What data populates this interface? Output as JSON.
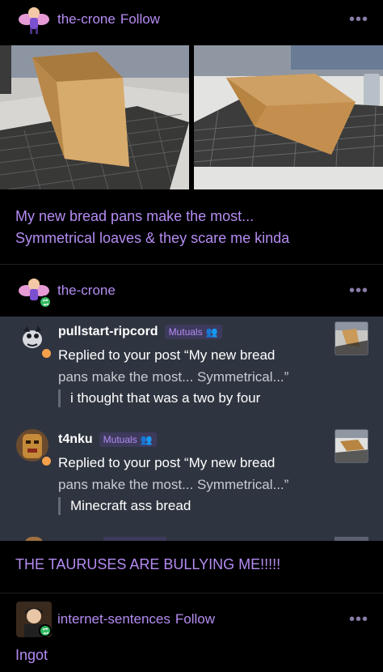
{
  "post1": {
    "blog": "the-crone",
    "follow": "Follow",
    "more": "•••",
    "text_line1": "My new bread pans make the most...",
    "text_line2": "Symmetrical loaves & they scare me kinda"
  },
  "reblog": {
    "blog": "the-crone",
    "more": "•••"
  },
  "notes": [
    {
      "user": "pullstart-ripcord",
      "badge": "Mutuals",
      "line1": "Replied to your post “My new bread",
      "line2": "pans make the most... Symmetrical...”",
      "reply": "i thought that was a two by four"
    },
    {
      "user": "t4nku",
      "badge": "Mutuals",
      "line1": "Replied to your post “My new bread",
      "line2": "pans make the most... Symmetrical...”",
      "reply": "Minecraft ass bread"
    }
  ],
  "reblog_text": "THE TAURUSES ARE BULLYING ME!!!!!",
  "post2": {
    "blog": "internet-sentences",
    "follow": "Follow",
    "more": "•••",
    "text": "Ingot"
  },
  "colors": {
    "accent": "#b48cf2",
    "background": "#000000",
    "notes_bg": "#2f3540",
    "reblog_badge": "#2fb85c",
    "reply_badge": "#f5a04a"
  }
}
